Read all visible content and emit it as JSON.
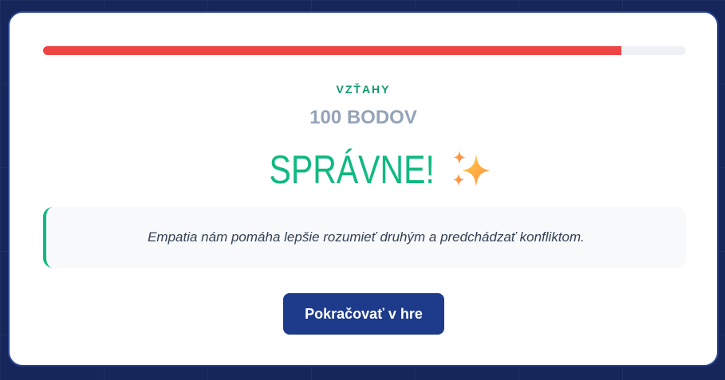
{
  "progress": {
    "fraction": 0.9
  },
  "question": {
    "category": "VZŤAHY",
    "points": "100 BODOV"
  },
  "result": {
    "title": "SPRÁVNE!",
    "icon": "sparkles-icon"
  },
  "explanation": {
    "text": "Empatia nám pomáha lepšie rozumieť druhým a predchádzať konfliktom."
  },
  "actions": {
    "continue_label": "Pokračovať v hre"
  },
  "colors": {
    "background": "#17265a",
    "progress": "#ef4444",
    "category": "#0f9a6c",
    "success": "#10b981",
    "button": "#1e3a8a"
  }
}
